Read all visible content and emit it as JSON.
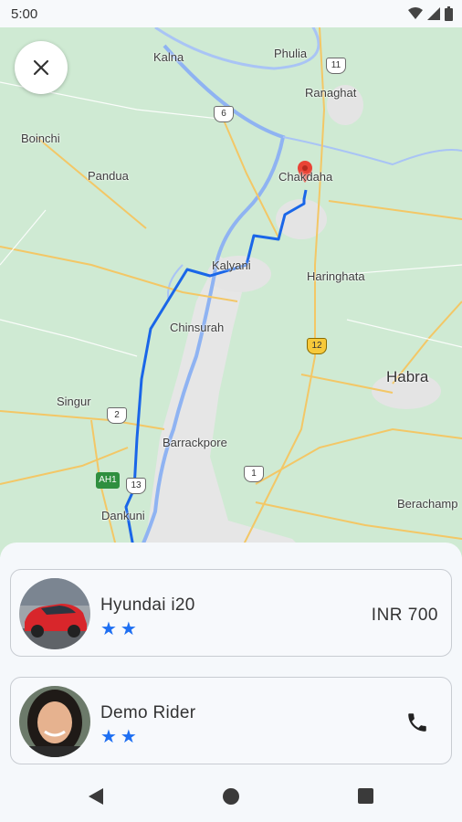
{
  "status_bar": {
    "time": "5:00"
  },
  "map": {
    "places": {
      "phulia": "Phulia",
      "kalna": "Kalna",
      "ranaghat": "Ranaghat",
      "boinchi": "Boinchi",
      "pandua": "Pandua",
      "chakdaha": "Chakdaha",
      "kalyani": "Kalyani",
      "haringhata": "Haringhata",
      "chinsurah": "Chinsurah",
      "habra": "Habra",
      "singur": "Singur",
      "barrackpore": "Barrackpore",
      "dankuni": "Dankuni",
      "berachampa": "Berachamp"
    },
    "shields": {
      "s11": "11",
      "s6": "6",
      "s12": "12",
      "s2": "2",
      "s1": "1",
      "s13": "13",
      "ah1": "AH1"
    }
  },
  "ride": {
    "car_name": "Hyundai i20",
    "car_rating_stars": "★★",
    "price": "INR 700"
  },
  "rider": {
    "name": "Demo Rider",
    "rating_stars": "★★"
  },
  "colors": {
    "route": "#1a66e8",
    "star": "#1e6ff2",
    "pin": "#e94335"
  },
  "icons": [
    "close-icon",
    "phone-icon",
    "map-pin-icon",
    "wifi-icon",
    "signal-icon",
    "battery-icon",
    "back-icon",
    "home-icon",
    "recents-icon"
  ]
}
